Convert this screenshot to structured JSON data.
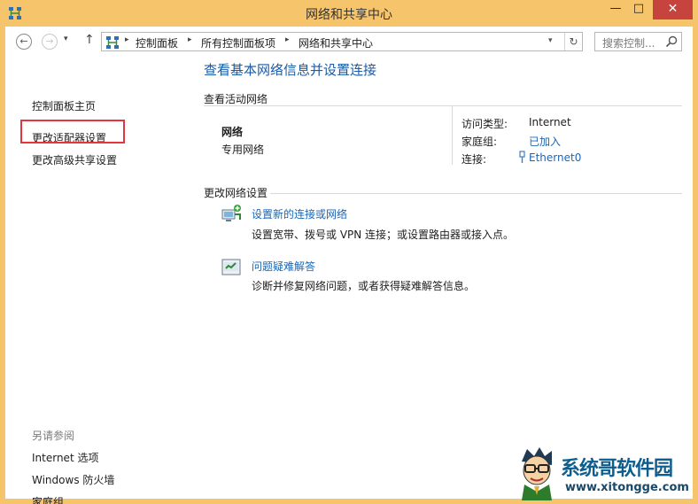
{
  "window": {
    "title": "网络和共享中心",
    "minimize": "—",
    "maximize": "□",
    "close": "✕"
  },
  "navbar": {
    "back": "←",
    "forward": "→",
    "recent": "▾",
    "up": "↑",
    "breadcrumbs": [
      "控制面板",
      "所有控制面板项",
      "网络和共享中心"
    ],
    "crumb_sep": "▸",
    "address_dropdown": "▾",
    "refresh": "↻",
    "search_placeholder": "搜索控制..."
  },
  "sidebar": {
    "home": "控制面板主页",
    "links": [
      "更改适配器设置",
      "更改高级共享设置"
    ],
    "see_also_label": "另请参阅",
    "see_also": [
      "Internet 选项",
      "Windows 防火墙",
      "家庭组"
    ]
  },
  "main": {
    "heading": "查看基本网络信息并设置连接",
    "active_networks_label": "查看活动网络",
    "network": {
      "name": "网络",
      "type": "专用网络"
    },
    "details": [
      {
        "key": "访问类型:",
        "value": "Internet",
        "link": false
      },
      {
        "key": "家庭组:",
        "value": "已加入",
        "link": true
      },
      {
        "key": "连接:",
        "value": "Ethernet0",
        "link": true
      }
    ],
    "change_settings_label": "更改网络设置",
    "tasks": [
      {
        "title": "设置新的连接或网络",
        "desc": "设置宽带、拨号或 VPN 连接；或设置路由器或接入点。",
        "icon": "network-setup-icon"
      },
      {
        "title": "问题疑难解答",
        "desc": "诊断并修复网络问题，或者获得疑难解答信息。",
        "icon": "troubleshoot-icon"
      }
    ]
  },
  "watermark": {
    "name": "系统哥软件园",
    "url": "www.xitongge.com"
  },
  "colors": {
    "frame": "#f5c46b",
    "link": "#1c66b5",
    "heading": "#1a5aa6",
    "highlight": "#e5343b"
  }
}
